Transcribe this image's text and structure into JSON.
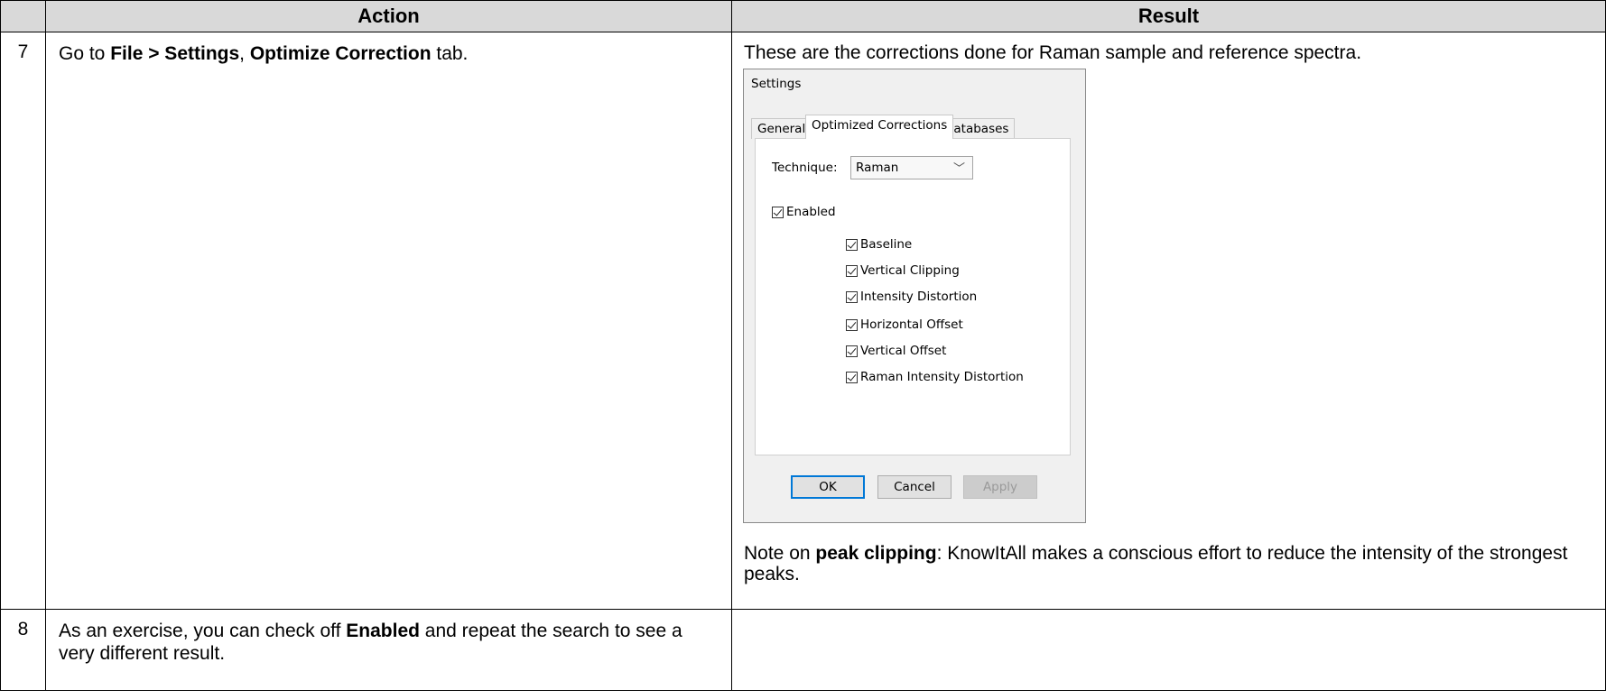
{
  "table": {
    "header_action": "Action",
    "header_result": "Result"
  },
  "row7": {
    "number": "7",
    "action_prefix": "Go to ",
    "action_bold1": "File > Settings",
    "action_sep": ", ",
    "action_bold2": "Optimize Correction",
    "action_suffix": " tab.",
    "result_intro": "These are the corrections done for Raman sample and reference spectra.",
    "note_prefix": "Note on ",
    "note_bold": "peak clipping",
    "note_suffix": ": KnowItAll makes a conscious effort to reduce the intensity of the strongest peaks."
  },
  "dialog": {
    "title": "Settings",
    "tabs": [
      "General",
      "Optimized Corrections",
      "Databases"
    ],
    "active_tab": "Optimized Corrections",
    "technique_label": "Technique:",
    "technique_value": "Raman",
    "enabled_label": "Enabled",
    "corrections": [
      "Baseline",
      "Vertical Clipping",
      "Intensity Distortion",
      "Horizontal Offset",
      "Vertical Offset",
      "Raman Intensity Distortion"
    ],
    "ok_label": "OK",
    "cancel_label": "Cancel",
    "apply_label": "Apply",
    "checkbox_icon": "checkmark-icon",
    "chevron_icon": "chevron-down-icon"
  },
  "row8": {
    "number": "8",
    "action_prefix": "As an exercise, you can check off ",
    "action_bold": "Enabled",
    "action_suffix": " and repeat the search to see a very different result.",
    "result": ""
  }
}
